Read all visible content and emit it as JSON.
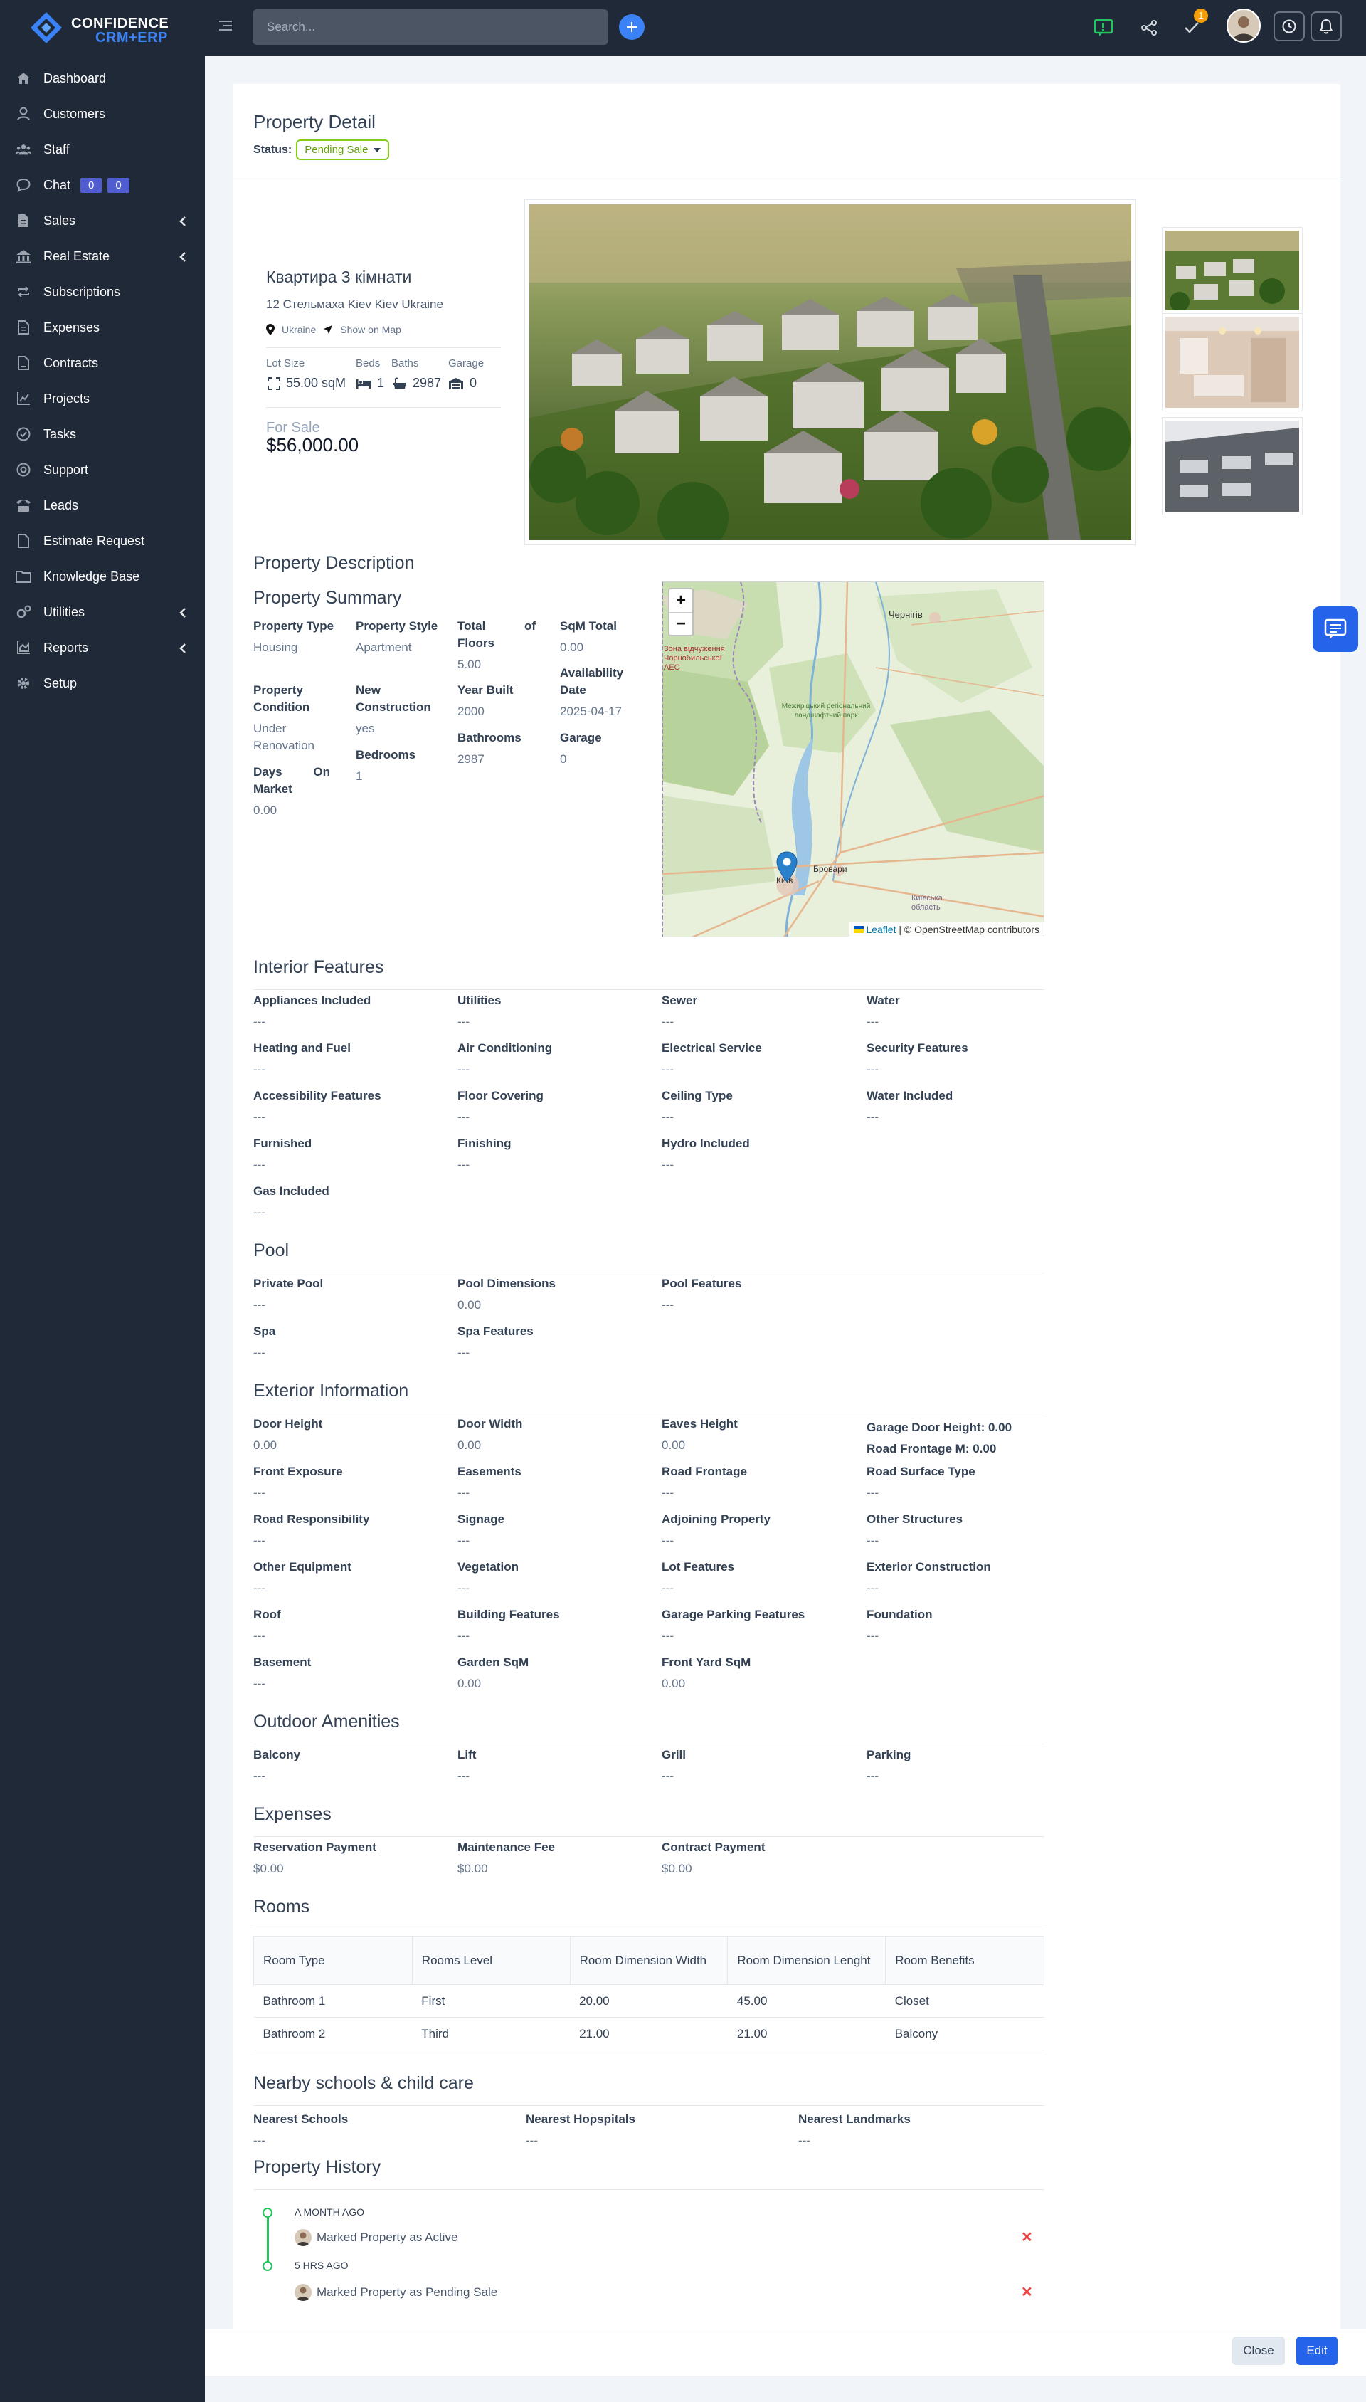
{
  "brand": {
    "line1": "CONFIDENCE",
    "line2": "CRM+ERP"
  },
  "topbar": {
    "search_placeholder": "Search...",
    "notification_count": "1"
  },
  "sidebar": {
    "items": [
      {
        "label": "Dashboard",
        "icon": "home-icon"
      },
      {
        "label": "Customers",
        "icon": "user-icon"
      },
      {
        "label": "Staff",
        "icon": "users-icon"
      },
      {
        "label": "Chat",
        "icon": "chat-icon",
        "badges": [
          "0",
          "0"
        ]
      },
      {
        "label": "Sales",
        "icon": "file-icon",
        "has_children": true
      },
      {
        "label": "Real Estate",
        "icon": "building-icon",
        "has_children": true
      },
      {
        "label": "Subscriptions",
        "icon": "repeat-icon"
      },
      {
        "label": "Expenses",
        "icon": "file-text-icon"
      },
      {
        "label": "Contracts",
        "icon": "contract-icon"
      },
      {
        "label": "Projects",
        "icon": "chart-icon"
      },
      {
        "label": "Tasks",
        "icon": "check-circle-icon"
      },
      {
        "label": "Support",
        "icon": "support-icon"
      },
      {
        "label": "Leads",
        "icon": "tty-icon"
      },
      {
        "label": "Estimate Request",
        "icon": "document-icon"
      },
      {
        "label": "Knowledge Base",
        "icon": "folder-icon"
      },
      {
        "label": "Utilities",
        "icon": "cogs-icon",
        "has_children": true
      },
      {
        "label": "Reports",
        "icon": "chart-area-icon",
        "has_children": true
      },
      {
        "label": "Setup",
        "icon": "gear-icon"
      }
    ]
  },
  "header": {
    "title": "Property Detail",
    "status_label": "Status:",
    "status_value": "Pending Sale"
  },
  "property": {
    "name": "Квартира 3 кімнати",
    "address": "12 Стельмаха Kiev Kiev Ukraine",
    "country": "Ukraine",
    "show_on_map": "Show on Map",
    "specs": {
      "lot_size_label": "Lot Size",
      "lot_size": "55.00 sqM",
      "beds_label": "Beds",
      "beds": "1",
      "baths_label": "Baths",
      "baths": "2987",
      "garage_label": "Garage",
      "garage": "0"
    },
    "sale_label": "For Sale",
    "price": "$56,000.00"
  },
  "description_title": "Property Description",
  "summary": {
    "title": "Property Summary",
    "fields": {
      "type_label": "Property Type",
      "type": "Housing",
      "style_label": "Property Style",
      "style": "Apartment",
      "floors_label": "Total of Floors",
      "floors": "5.00",
      "sqm_label": "SqM Total",
      "sqm": "0.00",
      "avail_label": "Availability Date",
      "avail": "2025-04-17",
      "condition_label": "Property Condition",
      "condition": "Under Renovation",
      "newcon_label": "New Construction",
      "newcon": "yes",
      "year_label": "Year Built",
      "year": "2000",
      "bedrooms_label": "Bedrooms",
      "bedrooms": "1",
      "bathrooms_label": "Bathrooms",
      "bathrooms": "2987",
      "garage_label": "Garage",
      "garage": "0",
      "dom_label": "Days On Market",
      "dom": "0.00"
    }
  },
  "map": {
    "attrib_link": "Leaflet",
    "attrib_rest": "| © OpenStreetMap contributors",
    "labels": {
      "chernihiv": "Чернігів",
      "kyiv": "Київ",
      "brovary": "Бровари",
      "zone": "Зона відчуження Чорнобильської АЕС",
      "reserve": "Межиріцький регіональний ландшафтний парк",
      "oblast": "Київська область"
    }
  },
  "interior": {
    "title": "Interior Features",
    "rows": [
      [
        {
          "l": "Appliances Included",
          "v": "---"
        },
        {
          "l": "Utilities",
          "v": "---"
        },
        {
          "l": "Sewer",
          "v": "---"
        },
        {
          "l": "Water",
          "v": "---"
        }
      ],
      [
        {
          "l": "Heating and Fuel",
          "v": "---"
        },
        {
          "l": "Air Conditioning",
          "v": "---"
        },
        {
          "l": "Electrical Service",
          "v": "---"
        },
        {
          "l": "Security Features",
          "v": "---"
        }
      ],
      [
        {
          "l": "Accessibility Features",
          "v": "---"
        },
        {
          "l": "Floor Covering",
          "v": "---"
        },
        {
          "l": "Ceiling Type",
          "v": "---"
        },
        {
          "l": "Water Included",
          "v": "---"
        }
      ],
      [
        {
          "l": "Furnished",
          "v": "---"
        },
        {
          "l": "Finishing",
          "v": "---"
        },
        {
          "l": "Hydro Included",
          "v": "---"
        }
      ],
      [
        {
          "l": "Gas Included",
          "v": "---"
        }
      ]
    ]
  },
  "pool": {
    "title": "Pool",
    "rows": [
      [
        {
          "l": "Private Pool",
          "v": "---"
        },
        {
          "l": "Pool Dimensions",
          "v": "0.00"
        },
        {
          "l": "Pool Features",
          "v": "---"
        }
      ],
      [
        {
          "l": "Spa",
          "v": "---"
        },
        {
          "l": "Spa Features",
          "v": "---"
        }
      ]
    ]
  },
  "exterior": {
    "title": "Exterior Information",
    "garage_door": "Garage Door Height: 0.00",
    "road_frontage_m": "Road Frontage M: 0.00",
    "rows": [
      [
        {
          "l": "Door Height",
          "v": "0.00"
        },
        {
          "l": "Door Width",
          "v": "0.00"
        },
        {
          "l": "Eaves Height",
          "v": "0.00"
        }
      ],
      [
        {
          "l": "Front Exposure",
          "v": "---"
        },
        {
          "l": "Easements",
          "v": "---"
        },
        {
          "l": "Road Frontage",
          "v": "---"
        },
        {
          "l": "Road Surface Type",
          "v": "---"
        }
      ],
      [
        {
          "l": "Road Responsibility",
          "v": "---"
        },
        {
          "l": "Signage",
          "v": "---"
        },
        {
          "l": "Adjoining Property",
          "v": "---"
        },
        {
          "l": "Other Structures",
          "v": "---"
        }
      ],
      [
        {
          "l": "Other Equipment",
          "v": "---"
        },
        {
          "l": "Vegetation",
          "v": "---"
        },
        {
          "l": "Lot Features",
          "v": "---"
        },
        {
          "l": "Exterior Construction",
          "v": "---"
        }
      ],
      [
        {
          "l": "Roof",
          "v": "---"
        },
        {
          "l": "Building Features",
          "v": "---"
        },
        {
          "l": "Garage Parking Features",
          "v": "---"
        },
        {
          "l": "Foundation",
          "v": "---"
        }
      ],
      [
        {
          "l": "Basement",
          "v": "---"
        },
        {
          "l": "Garden SqM",
          "v": "0.00"
        },
        {
          "l": "Front Yard SqM",
          "v": "0.00"
        }
      ]
    ]
  },
  "outdoor": {
    "title": "Outdoor Amenities",
    "rows": [
      [
        {
          "l": "Balcony",
          "v": "---"
        },
        {
          "l": "Lift",
          "v": "---"
        },
        {
          "l": "Grill",
          "v": "---"
        },
        {
          "l": "Parking",
          "v": "---"
        }
      ]
    ]
  },
  "expenses": {
    "title": "Expenses",
    "rows": [
      [
        {
          "l": "Reservation Payment",
          "v": "$0.00"
        },
        {
          "l": "Maintenance Fee",
          "v": "$0.00"
        },
        {
          "l": "Contract Payment",
          "v": "$0.00"
        }
      ]
    ]
  },
  "rooms": {
    "title": "Rooms",
    "headers": [
      "Room Type",
      "Rooms Level",
      "Room Dimension Width",
      "Room Dimension Lenght",
      "Room Benefits"
    ],
    "rows": [
      [
        "Bathroom 1",
        "First",
        "20.00",
        "45.00",
        "Closet"
      ],
      [
        "Bathroom 2",
        "Third",
        "21.00",
        "21.00",
        "Balcony"
      ]
    ]
  },
  "nearby": {
    "title": "Nearby schools & child care",
    "items": [
      {
        "l": "Nearest Schools",
        "v": "---"
      },
      {
        "l": "Nearest Hopspitals",
        "v": "---"
      },
      {
        "l": "Nearest Landmarks",
        "v": "---"
      }
    ]
  },
  "history": {
    "title": "Property History",
    "entries": [
      {
        "time": "A MONTH AGO",
        "text": "Marked Property as Active"
      },
      {
        "time": "5 HRS AGO",
        "text": "Marked Property as Pending Sale"
      }
    ]
  },
  "footer": {
    "close_label": "Close",
    "edit_label": "Edit"
  }
}
